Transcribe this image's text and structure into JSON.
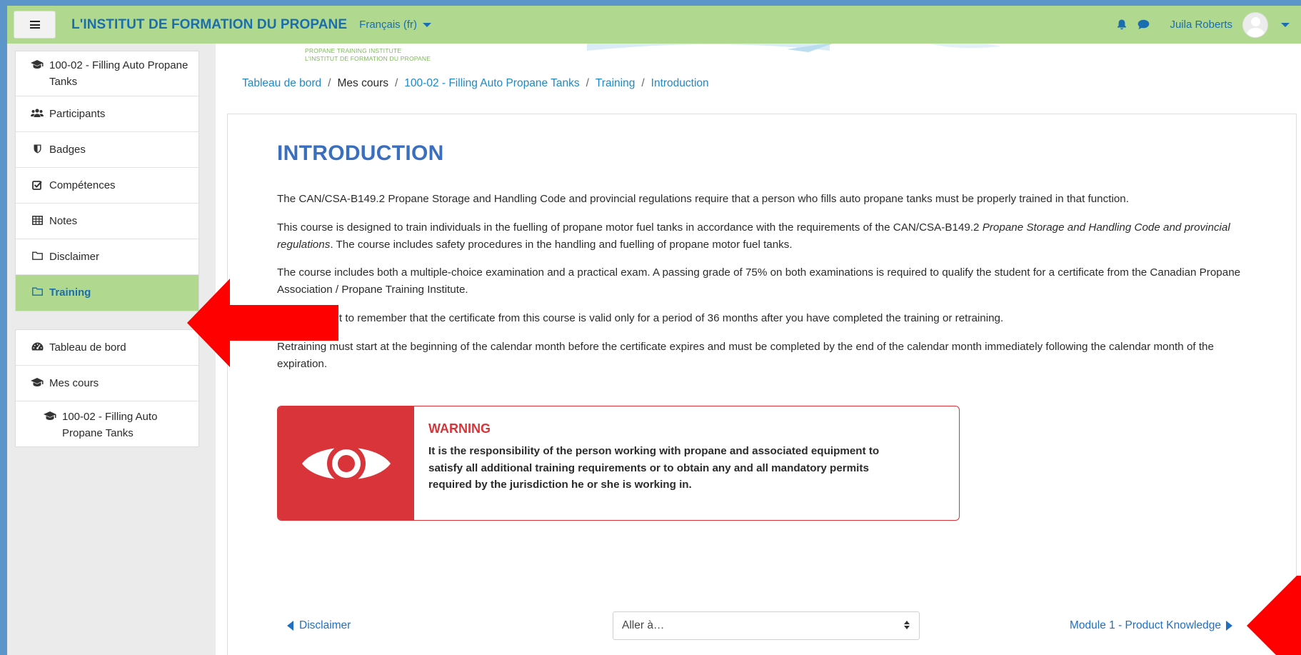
{
  "navbar": {
    "brand": "L'INSTITUT DE FORMATION DU PROPANE",
    "language": "Français (fr)",
    "user_name": "Juila Roberts",
    "icons": [
      "hamburger-menu-icon",
      "bell-icon",
      "chat-bubble-icon",
      "avatar",
      "chevron-down-icon"
    ]
  },
  "banner": {
    "line1": "PROPANE TRAINING INSTITUTE",
    "line2": "L'INSTITUT DE FORMATION DU PROPANE"
  },
  "sidebar": {
    "course_items": [
      {
        "label": "100-02 - Filling Auto Propane Tanks",
        "icon": "graduation-cap-icon"
      },
      {
        "label": "Participants",
        "icon": "users-icon"
      },
      {
        "label": "Badges",
        "icon": "shield-icon"
      },
      {
        "label": "Compétences",
        "icon": "check-square-icon"
      },
      {
        "label": "Notes",
        "icon": "table-icon"
      },
      {
        "label": "Disclaimer",
        "icon": "folder-icon"
      },
      {
        "label": "Training",
        "icon": "folder-icon",
        "active": true
      }
    ],
    "site_items": [
      {
        "label": "Tableau de bord",
        "icon": "dashboard-icon"
      },
      {
        "label": "Mes cours",
        "icon": "graduation-cap-icon"
      },
      {
        "label": "100-02 - Filling Auto Propane Tanks",
        "icon": "graduation-cap-icon"
      }
    ]
  },
  "breadcrumb": [
    "Tableau de bord",
    "Mes cours",
    "100-02 - Filling Auto Propane Tanks",
    "Training",
    "Introduction"
  ],
  "page": {
    "title": "INTRODUCTION",
    "p1": "The CAN/CSA-B149.2 Propane Storage and Handling Code and provincial regulations require that a person who fills auto propane tanks must be properly trained in that function.",
    "p2_a": "This course is designed to train individuals in the fuelling of propane motor fuel tanks in accordance with the requirements of the CAN/CSA-B149.2 ",
    "p2_em": "Propane Storage and Handling Code and provincial regulations",
    "p2_b": ". The course includes safety procedures in the handling  and fuelling of propane motor fuel tanks.",
    "p3": "The course includes both a multiple-choice examination and a practical exam. A passing grade of 75% on both examinations is required to qualify the student for a certificate from the Canadian Propane Association / Propane Training Institute.",
    "p4": "It is important to remember that the certificate from this course is valid only for a period of 36 months after you have completed the training or retraining.",
    "p5": "Retraining must start at the beginning of the calendar month before the certificate expires and must be completed by the end of the calendar month immediately following the calendar month of the expiration."
  },
  "warning": {
    "title": "WARNING",
    "body": "It is the responsibility of the person working with propane and associated equipment to satisfy all additional training requirements or to obtain any and all mandatory permits required by the jurisdiction he or she is working in.",
    "icon": "eye-icon",
    "color": "#d8343a"
  },
  "activity_nav": {
    "prev": "Disclaimer",
    "jump_placeholder": "Aller à…",
    "next": "Module 1 - Product Knowledge"
  },
  "colors": {
    "navbar": "#b0d88e",
    "brand": "#1a6eb0",
    "link": "#1f87c6",
    "title": "#3a6fc0",
    "annotation_arrow": "#ff0000"
  }
}
